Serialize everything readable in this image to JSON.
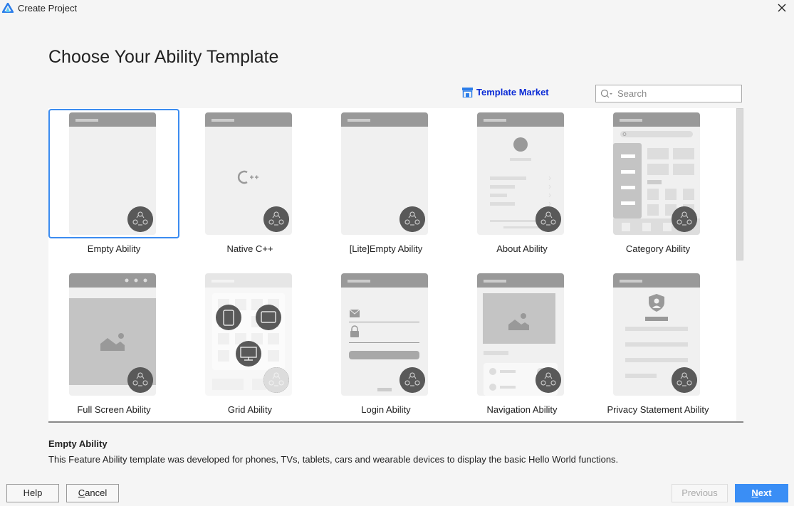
{
  "window": {
    "title": "Create Project",
    "logo_icon": "deveco-logo-icon",
    "close_icon": "close-icon"
  },
  "page": {
    "title": "Choose Your Ability Template"
  },
  "toolbar": {
    "market_label": "Template Market",
    "market_icon": "store-icon",
    "search_placeholder": "Search",
    "search_value": ""
  },
  "colors": {
    "accent": "#3c8cf0",
    "link": "#0a2bd6",
    "next_button": "#3a8ef5"
  },
  "templates": [
    {
      "label": "Empty Ability",
      "preview": "empty",
      "selected": true
    },
    {
      "label": "Native C++",
      "preview": "cpp",
      "selected": false
    },
    {
      "label": "[Lite]Empty Ability",
      "preview": "empty",
      "selected": false
    },
    {
      "label": "About Ability",
      "preview": "about",
      "selected": false
    },
    {
      "label": "Category Ability",
      "preview": "category",
      "selected": false
    },
    {
      "label": "Full Screen Ability",
      "preview": "fullscreen",
      "selected": false
    },
    {
      "label": "Grid Ability",
      "preview": "grid",
      "selected": false
    },
    {
      "label": "Login Ability",
      "preview": "login",
      "selected": false
    },
    {
      "label": "Navigation Ability",
      "preview": "navigation",
      "selected": false
    },
    {
      "label": "Privacy Statement Ability",
      "preview": "privacy",
      "selected": false
    }
  ],
  "description": {
    "title": "Empty Ability",
    "text": "This Feature Ability template was developed for phones, TVs, tablets, cars and wearable devices to display the basic Hello World functions."
  },
  "buttons": {
    "help": "Help",
    "cancel_mnemonic": "C",
    "cancel_rest": "ancel",
    "previous": "Previous",
    "next_mnemonic": "N",
    "next_rest": "ext"
  }
}
